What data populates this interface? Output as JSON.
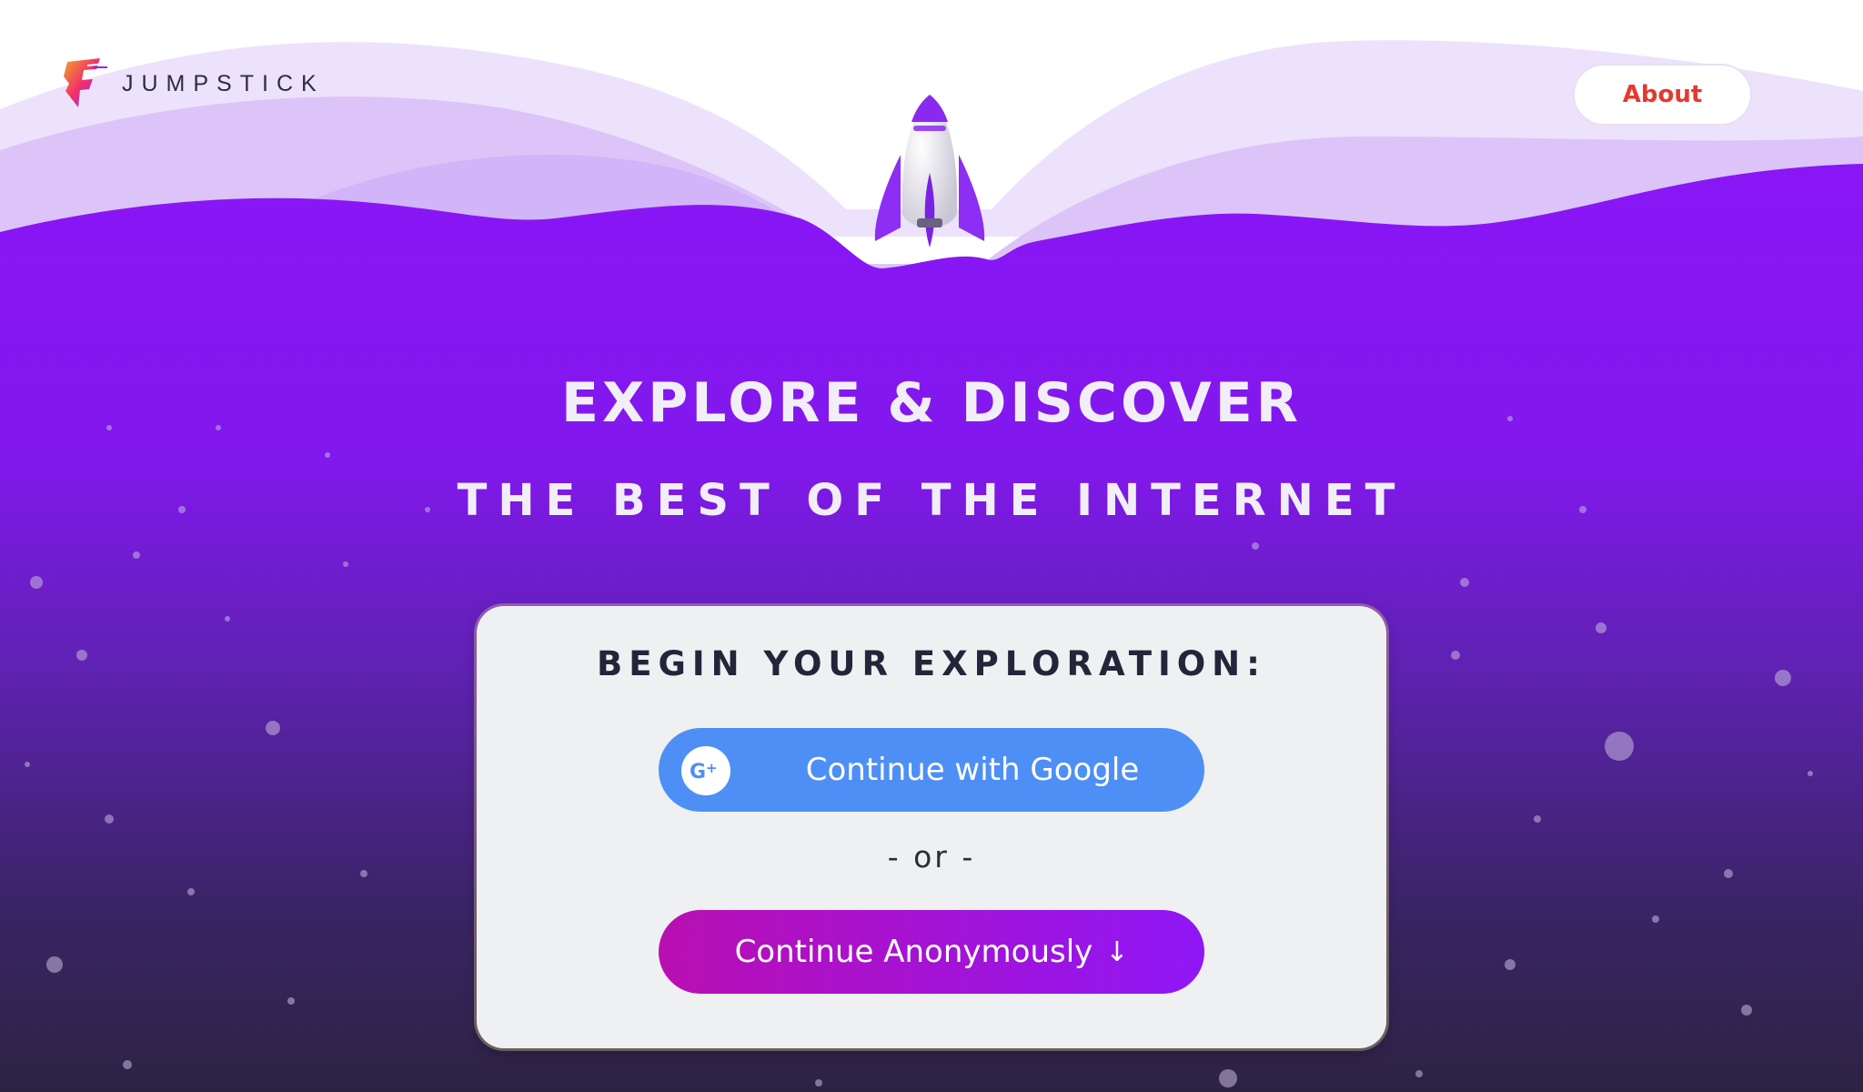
{
  "brand": {
    "name": "JUMPSTICK",
    "logo_icon": "jumpstick-logo-icon"
  },
  "header": {
    "about_label": "About"
  },
  "hero": {
    "title": "EXPLORE & DISCOVER",
    "subtitle": "THE BEST OF THE INTERNET",
    "illustration": "rocket-icon"
  },
  "card": {
    "heading": "BEGIN YOUR EXPLORATION:",
    "google_label": "Continue with Google",
    "google_icon": "google-plus-icon",
    "or_text": "- or -",
    "anon_label": "Continue Anonymously",
    "anon_icon": "arrow-down-icon"
  },
  "colors": {
    "purple_bright": "#8b17f5",
    "purple_dark": "#2d2343",
    "google_blue": "#4e8ff5",
    "about_red": "#e5392f",
    "card_bg": "#eff0f2"
  }
}
